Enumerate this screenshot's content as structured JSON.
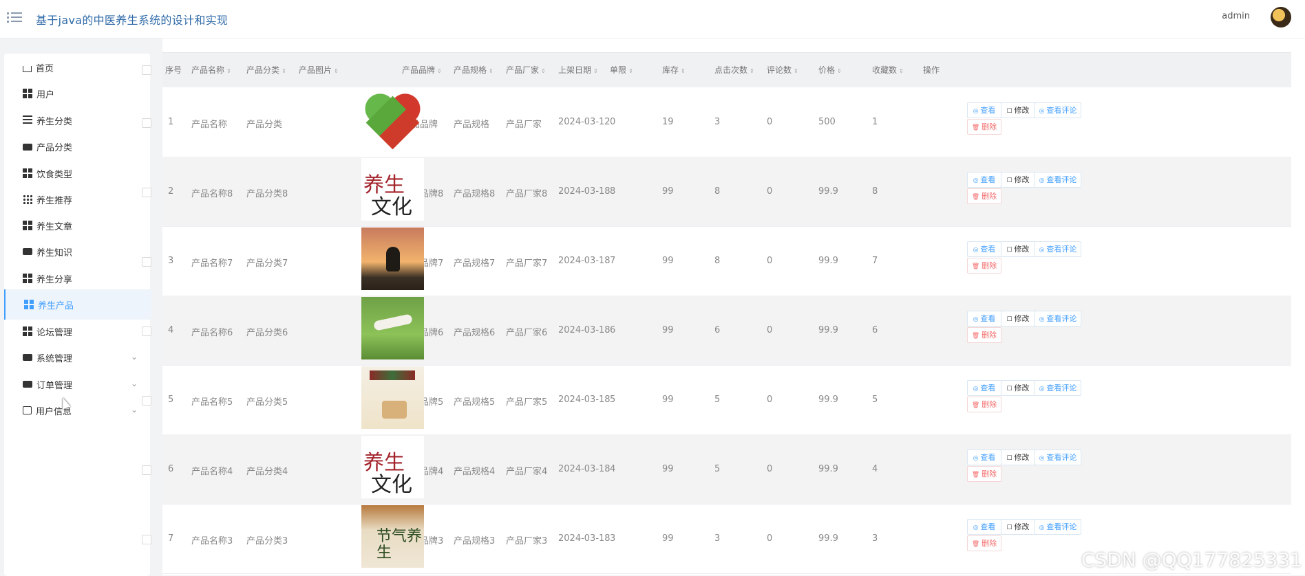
{
  "header": {
    "title": "基于java的中医养生系统的设计和实现",
    "user": "admin"
  },
  "sidebar": {
    "items": [
      {
        "label": "首页",
        "icon": "home-icon"
      },
      {
        "label": "用户",
        "icon": "grid-icon"
      },
      {
        "label": "养生分类",
        "icon": "list-icon"
      },
      {
        "label": "产品分类",
        "icon": "chat-icon"
      },
      {
        "label": "饮食类型",
        "icon": "grid-icon"
      },
      {
        "label": "养生推荐",
        "icon": "apps-icon"
      },
      {
        "label": "养生文章",
        "icon": "grid-icon"
      },
      {
        "label": "养生知识",
        "icon": "monitor-icon"
      },
      {
        "label": "养生分享",
        "icon": "grid-icon"
      },
      {
        "label": "养生产品",
        "icon": "grid-icon",
        "active": true
      },
      {
        "label": "论坛管理",
        "icon": "grid-icon"
      },
      {
        "label": "系统管理",
        "icon": "monitor-icon",
        "expandable": true
      },
      {
        "label": "订单管理",
        "icon": "clipboard-icon",
        "expandable": true
      },
      {
        "label": "用户信息",
        "icon": "card-icon",
        "expandable": true
      }
    ]
  },
  "table": {
    "columns": [
      "序号",
      "产品名称",
      "产品分类",
      "产品图片",
      "产品品牌",
      "产品规格",
      "产品厂家",
      "上架日期",
      "单限",
      "库存",
      "点击次数",
      "评论数",
      "价格",
      "收藏数",
      "操作"
    ],
    "rows": [
      {
        "no": "1",
        "name": "产品名称",
        "category": "产品分类",
        "image": "heart",
        "brand": "产品品牌",
        "spec": "产品规格",
        "maker": "产品厂家",
        "date": "2024-03-12",
        "limit": "0",
        "stock": "19",
        "clicks": "3",
        "comments": "0",
        "price": "500",
        "favs": "1"
      },
      {
        "no": "2",
        "name": "产品名称8",
        "category": "产品分类8",
        "image": "text",
        "brand": "产品品牌8",
        "spec": "产品规格8",
        "maker": "产品厂家8",
        "date": "2024-03-18",
        "limit": "8",
        "stock": "99",
        "clicks": "8",
        "comments": "0",
        "price": "99.9",
        "favs": "8"
      },
      {
        "no": "3",
        "name": "产品名称7",
        "category": "产品分类7",
        "image": "yoga",
        "brand": "产品品牌7",
        "spec": "产品规格7",
        "maker": "产品厂家7",
        "date": "2024-03-18",
        "limit": "7",
        "stock": "99",
        "clicks": "8",
        "comments": "0",
        "price": "99.9",
        "favs": "7"
      },
      {
        "no": "4",
        "name": "产品名称6",
        "category": "产品分类6",
        "image": "yoga2",
        "brand": "产品品牌6",
        "spec": "产品规格6",
        "maker": "产品厂家6",
        "date": "2024-03-18",
        "limit": "6",
        "stock": "99",
        "clicks": "6",
        "comments": "0",
        "price": "99.9",
        "favs": "6"
      },
      {
        "no": "5",
        "name": "产品名称5",
        "category": "产品分类5",
        "image": "book",
        "brand": "产品品牌5",
        "spec": "产品规格5",
        "maker": "产品厂家5",
        "date": "2024-03-18",
        "limit": "5",
        "stock": "99",
        "clicks": "5",
        "comments": "0",
        "price": "99.9",
        "favs": "5"
      },
      {
        "no": "6",
        "name": "产品名称4",
        "category": "产品分类4",
        "image": "text",
        "brand": "产品品牌4",
        "spec": "产品规格4",
        "maker": "产品厂家4",
        "date": "2024-03-18",
        "limit": "4",
        "stock": "99",
        "clicks": "5",
        "comments": "0",
        "price": "99.9",
        "favs": "4"
      },
      {
        "no": "7",
        "name": "产品名称3",
        "category": "产品分类3",
        "image": "food",
        "brand": "产品品牌3",
        "spec": "产品规格3",
        "maker": "产品厂家3",
        "date": "2024-03-18",
        "limit": "3",
        "stock": "99",
        "clicks": "3",
        "comments": "0",
        "price": "99.9",
        "favs": "3"
      }
    ],
    "actions": {
      "view": "查看",
      "edit": "修改",
      "view_comments": "查看评论",
      "delete": "删除"
    }
  },
  "image_text": {
    "text_a": "养生",
    "text_b": "文化",
    "food": "节气养生"
  },
  "watermark": "CSDN @QQ177825331"
}
